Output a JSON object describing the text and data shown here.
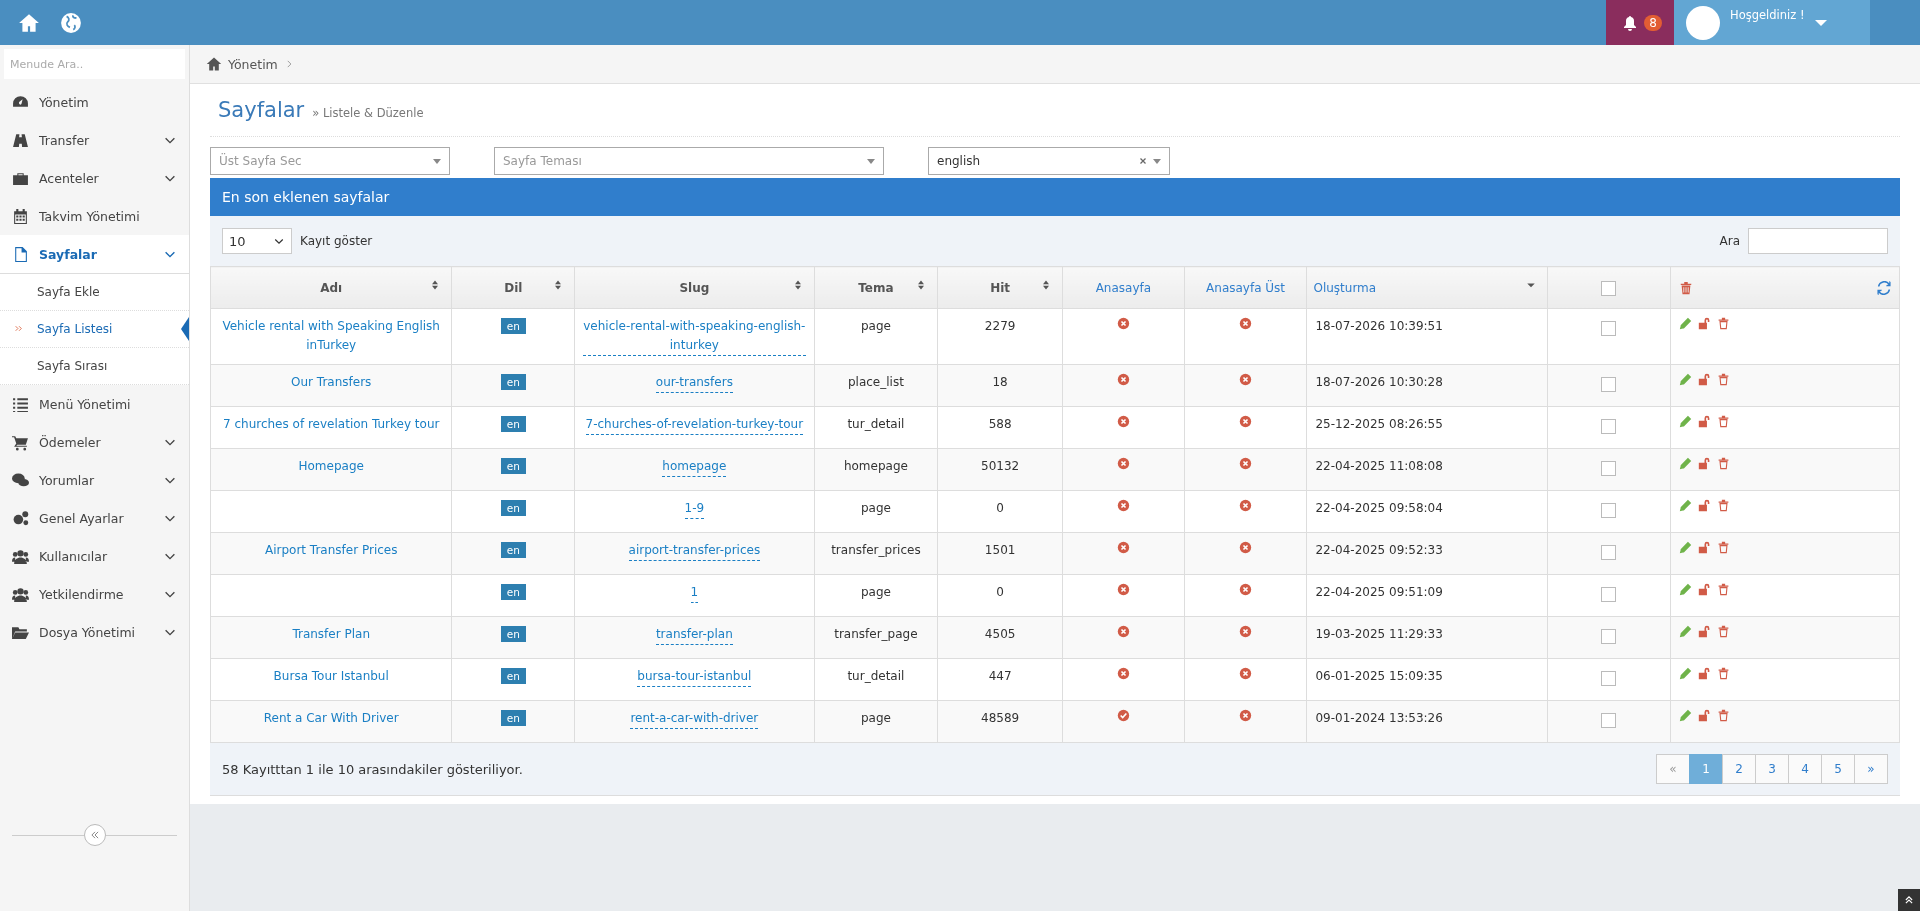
{
  "topbar": {
    "notifications": {
      "count": "8"
    },
    "user": {
      "greeting": "Hoşgeldiniz !"
    }
  },
  "sidebar": {
    "search": {
      "placeholder": "Menude Ara.."
    },
    "items": [
      {
        "label": "Yönetim",
        "has_submenu": false,
        "selected": false
      },
      {
        "label": "Transfer",
        "has_submenu": true,
        "selected": false
      },
      {
        "label": "Acenteler",
        "has_submenu": true,
        "selected": false
      },
      {
        "label": "Takvim Yönetimi",
        "has_submenu": false,
        "selected": false
      },
      {
        "label": "Sayfalar",
        "has_submenu": true,
        "selected": true,
        "children": [
          {
            "label": "Sayfa Ekle",
            "selected": false
          },
          {
            "label": "Sayfa Listesi",
            "selected": true
          },
          {
            "label": "Sayfa Sırası",
            "selected": false
          }
        ]
      },
      {
        "label": "Menü Yönetimi",
        "has_submenu": false,
        "selected": false
      },
      {
        "label": "Ödemeler",
        "has_submenu": true,
        "selected": false
      },
      {
        "label": "Yorumlar",
        "has_submenu": true,
        "selected": false
      },
      {
        "label": "Genel Ayarlar",
        "has_submenu": true,
        "selected": false
      },
      {
        "label": "Kullanıcılar",
        "has_submenu": true,
        "selected": false
      },
      {
        "label": "Yetkilendirme",
        "has_submenu": true,
        "selected": false
      },
      {
        "label": "Dosya Yönetimi",
        "has_submenu": true,
        "selected": false
      }
    ]
  },
  "breadcrumb": [
    "Yönetim"
  ],
  "page": {
    "title": "Sayfalar",
    "subtitle": "» Listele & Düzenle"
  },
  "filters": [
    {
      "placeholder": "Üst Sayfa Sec"
    },
    {
      "placeholder": "Sayfa Teması"
    },
    {
      "value": "english"
    }
  ],
  "panel": {
    "title": "En son eklenen sayfalar",
    "page_size": "10",
    "page_size_label": "Kayıt göster",
    "search_label": "Ara"
  },
  "table": {
    "select_all_checked": false,
    "columns": [
      {
        "label": "Adı",
        "sortable": true,
        "sorted": false
      },
      {
        "label": "Dil",
        "sortable": true,
        "sorted": false
      },
      {
        "label": "Slug",
        "sortable": true,
        "sorted": false
      },
      {
        "label": "Tema",
        "sortable": true,
        "sorted": false
      },
      {
        "label": "Hit",
        "sortable": true,
        "sorted": false
      },
      {
        "label": "Anasayfa",
        "sortable": false,
        "sorted": false
      },
      {
        "label": "Anasayfa Üst",
        "sortable": false,
        "sorted": false
      },
      {
        "label": "Oluşturma",
        "sortable": true,
        "sorted": true
      }
    ],
    "rows": [
      {
        "name": "Vehicle rental with Speaking English inTurkey",
        "lang": "en",
        "slug": "vehicle-rental-with-speaking-english-inturkey",
        "theme": "page",
        "hit": "2279",
        "home": false,
        "home_top": false,
        "created": "18-07-2026 10:39:51",
        "checked": false
      },
      {
        "name": "Our Transfers",
        "lang": "en",
        "slug": "our-transfers",
        "theme": "place_list",
        "hit": "18",
        "home": false,
        "home_top": false,
        "created": "18-07-2026 10:30:28",
        "checked": false
      },
      {
        "name": "7 churches of revelation Turkey tour",
        "lang": "en",
        "slug": "7-churches-of-revelation-turkey-tour",
        "theme": "tur_detail",
        "hit": "588",
        "home": false,
        "home_top": false,
        "created": "25-12-2025 08:26:55",
        "checked": false
      },
      {
        "name": "Homepage",
        "lang": "en",
        "slug": "homepage",
        "theme": "homepage",
        "hit": "50132",
        "home": false,
        "home_top": false,
        "created": "22-04-2025 11:08:08",
        "checked": false
      },
      {
        "lang": "en",
        "slug": "1-9",
        "theme": "page",
        "hit": "0",
        "home": false,
        "home_top": false,
        "created": "22-04-2025 09:58:04",
        "checked": false
      },
      {
        "name": "Airport Transfer Prices",
        "lang": "en",
        "slug": "airport-transfer-prices",
        "theme": "transfer_prices",
        "hit": "1501",
        "home": false,
        "home_top": false,
        "created": "22-04-2025 09:52:33",
        "checked": false
      },
      {
        "lang": "en",
        "slug": "1",
        "theme": "page",
        "hit": "0",
        "home": false,
        "home_top": false,
        "created": "22-04-2025 09:51:09",
        "checked": false
      },
      {
        "name": "Transfer Plan",
        "lang": "en",
        "slug": "transfer-plan",
        "theme": "transfer_page",
        "hit": "4505",
        "home": false,
        "home_top": false,
        "created": "19-03-2025 11:29:33",
        "checked": false
      },
      {
        "name": "Bursa Tour Istanbul",
        "lang": "en",
        "slug": "bursa-tour-istanbul",
        "theme": "tur_detail",
        "hit": "447",
        "home": false,
        "home_top": false,
        "created": "06-01-2025 15:09:35",
        "checked": false
      },
      {
        "name": "Rent a Car With Driver",
        "lang": "en",
        "slug": "rent-a-car-with-driver",
        "theme": "page",
        "hit": "48589",
        "home": true,
        "home_top": false,
        "created": "09-01-2024 13:53:26",
        "checked": false
      }
    ]
  },
  "footer": {
    "info": "58 Kayıtttan 1 ile 10 arasındakiler gösteriliyor.",
    "pagination": [
      {
        "label": "«",
        "selected": false
      },
      {
        "label": "1",
        "selected": true
      },
      {
        "label": "2",
        "selected": false
      },
      {
        "label": "3",
        "selected": false
      },
      {
        "label": "4",
        "selected": false
      },
      {
        "label": "5",
        "selected": false
      },
      {
        "label": "»",
        "selected": false
      }
    ]
  }
}
